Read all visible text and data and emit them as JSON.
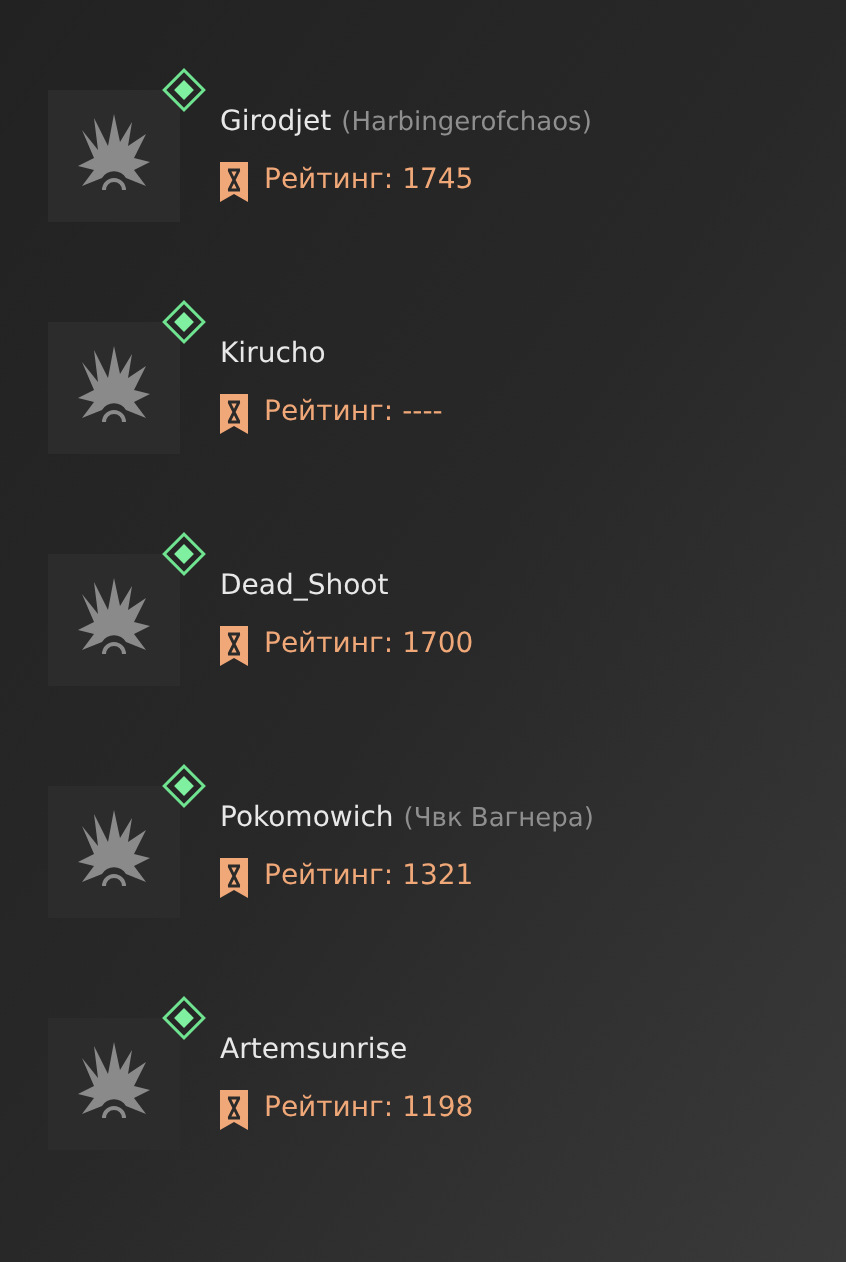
{
  "players": [
    {
      "name": "Girodjet",
      "clan": "(Harbingerofchaos)",
      "online": true,
      "rating": "Рейтинг: 1745"
    },
    {
      "name": "Kirucho",
      "online": true,
      "rating": "Рейтинг: ----"
    },
    {
      "name": "Dead_Shoot",
      "online": true,
      "rating": "Рейтинг: 1700"
    },
    {
      "name": "Pokomowich",
      "clan": "(Чвк Вагнера)",
      "online": true,
      "rating": "Рейтинг: 1321"
    },
    {
      "name": "Artemsunrise",
      "online": true,
      "rating": "Рейтинг: 1198"
    }
  ]
}
